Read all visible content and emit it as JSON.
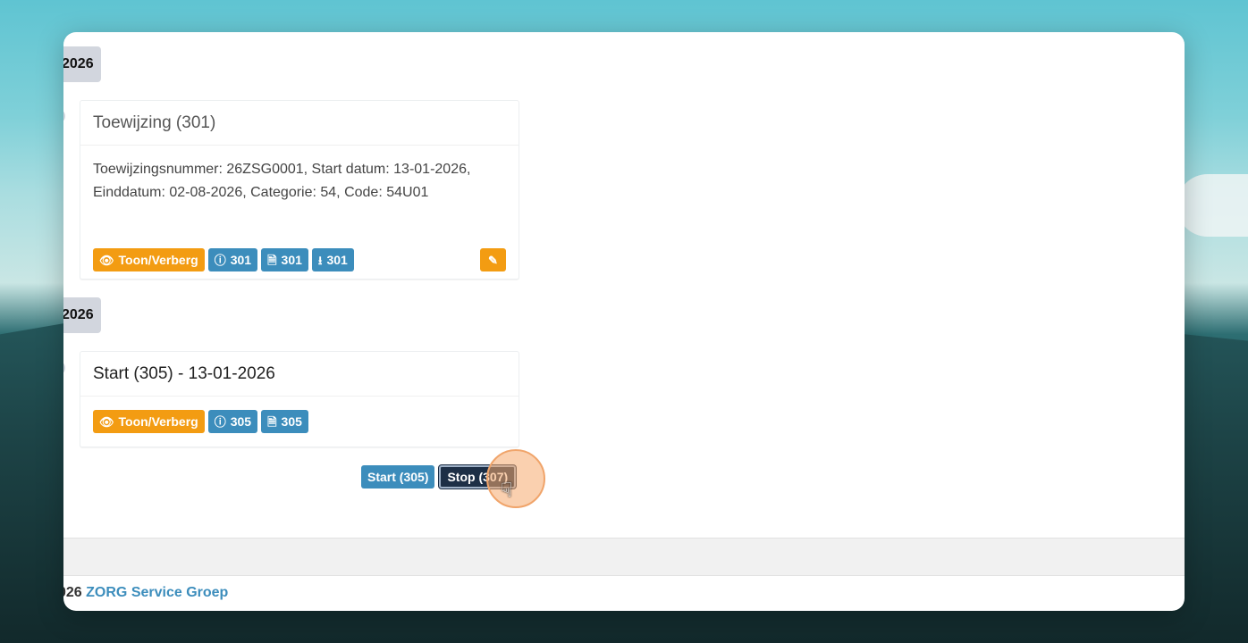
{
  "timeline": [
    {
      "date_label": "2026",
      "card": {
        "title": "Toewijzing (301)",
        "body_line1": "Toewijzingsnummer: 26ZSG0001, Start datum: 13-01-2026,",
        "body_line2": "Einddatum: 02-08-2026, Categorie: 54, Code: 54U01",
        "buttons": {
          "toggle": "Toon/Verberg",
          "info": "301",
          "pdf": "301",
          "download": "301"
        }
      }
    },
    {
      "date_label": "2026",
      "card": {
        "title": "Start (305) - 13-01-2026",
        "buttons": {
          "toggle": "Toon/Verberg",
          "info": "305",
          "pdf": "305"
        }
      }
    }
  ],
  "nav": {
    "start_label": "Start (305)",
    "stop_label": "Stop (307)"
  },
  "footer": {
    "year": "026",
    "brand": "ZORG Service Groep"
  },
  "icons": {
    "toggle": "eye-icon",
    "info": "info-icon",
    "pdf": "file-pdf-icon",
    "download": "download-icon",
    "edit": "pencil-icon",
    "cursor": "hand-pointer-icon"
  },
  "colors": {
    "orange": "#f39c12",
    "blue": "#3c8dbc",
    "dark": "#1d2f46",
    "badge": "#d2d6de"
  }
}
